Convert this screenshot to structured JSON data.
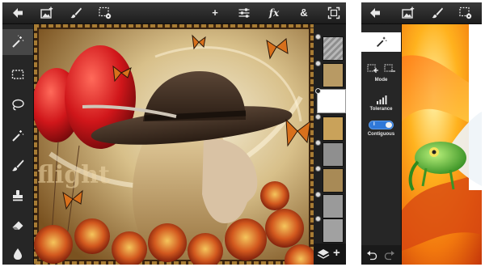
{
  "editor": {
    "toolbar": {
      "back_icon": "arrow-left-icon",
      "import_icon": "image-plus-icon",
      "brush_icon": "brush-icon",
      "selection_icon": "selection-gear-icon",
      "add_label": "+",
      "adjust_icon": "sliders-icon",
      "effects_label": "fx",
      "blend_label": "&",
      "fullscreen_icon": "frame-expand-icon"
    },
    "tools": [
      "magic-wand-icon",
      "marquee-icon",
      "lasso-icon",
      "magic-wand-icon",
      "brush-icon",
      "stamp-icon",
      "eraser-icon",
      "drop-icon"
    ],
    "canvas_text": "flight",
    "layers": {
      "count": 9,
      "selected_index": 2,
      "add_label": "+"
    }
  },
  "selection_panel": {
    "mode_label": "Mode",
    "tolerance_label": "Tolerance",
    "toggle_label": "I",
    "contiguous_label": "Contiguous"
  },
  "colors": {
    "toolbar": "#2b2b2b",
    "toggle": "#2f78d8",
    "canvas_frame": "#6a4a1e"
  }
}
